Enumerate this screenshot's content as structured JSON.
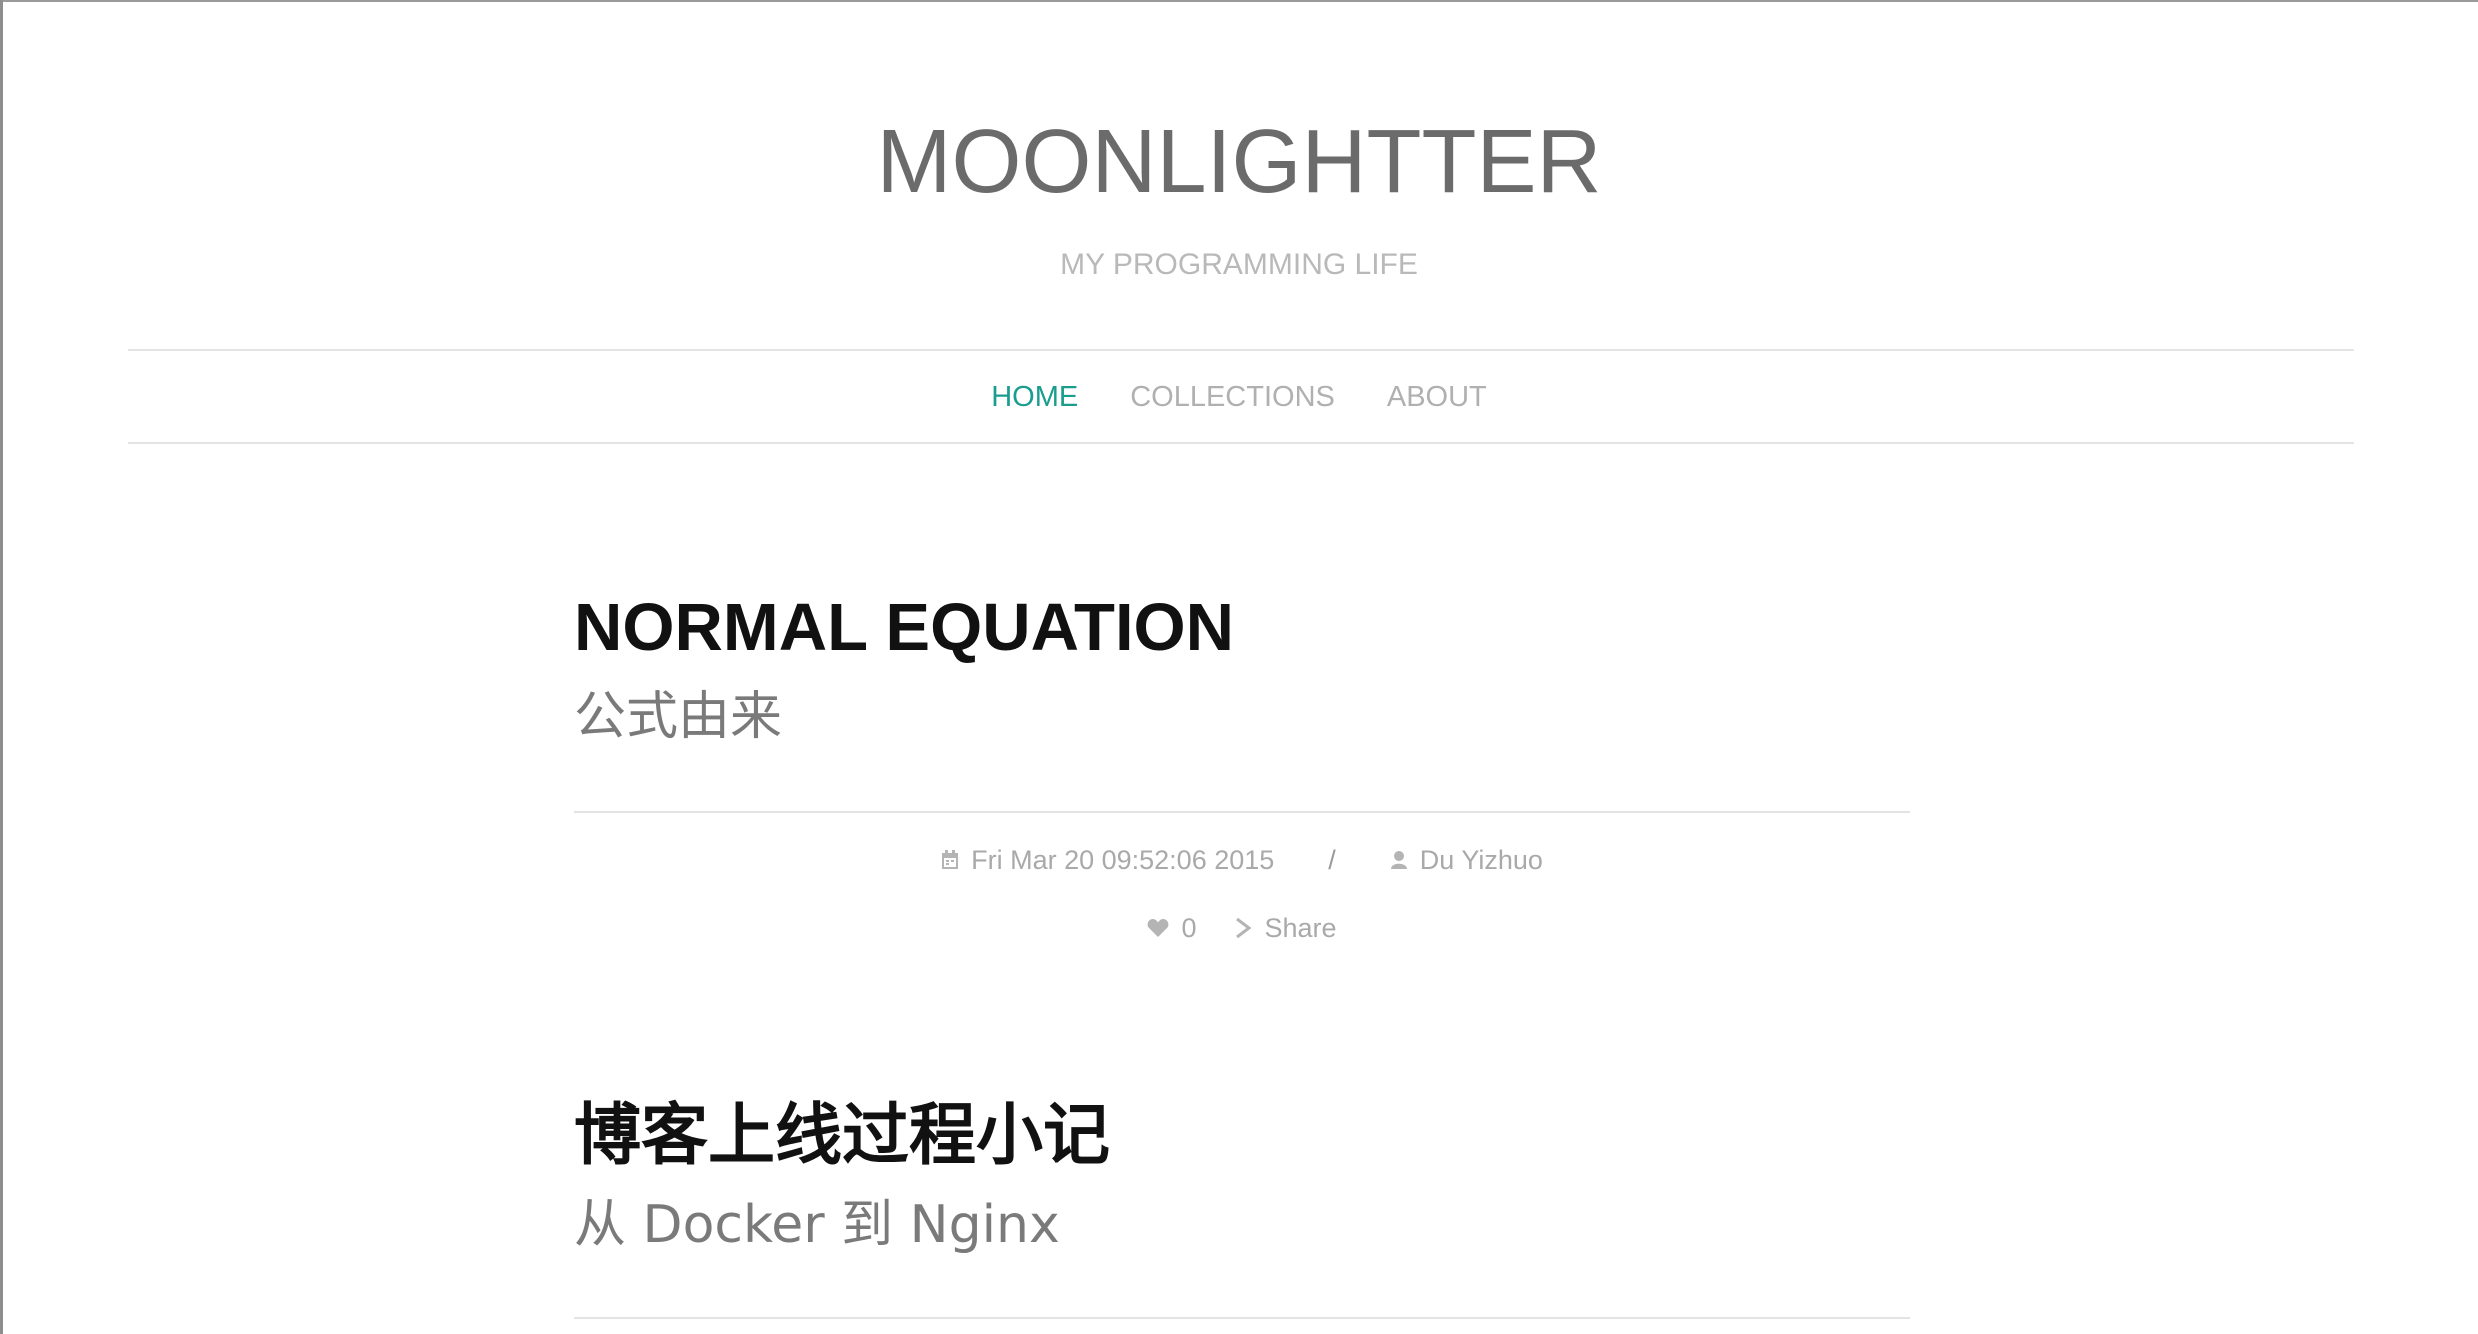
{
  "site": {
    "title": "MOONLIGHTTER",
    "subtitle": "MY PROGRAMMING LIFE"
  },
  "nav": {
    "items": [
      {
        "label": "HOME",
        "active": true
      },
      {
        "label": "COLLECTIONS",
        "active": false
      },
      {
        "label": "ABOUT",
        "active": false
      }
    ]
  },
  "posts": [
    {
      "title": "NORMAL EQUATION",
      "subtitle": "公式由来",
      "date": "Fri Mar 20 09:52:06 2015",
      "separator": "/",
      "author": "Du Yizhuo",
      "likes": "0",
      "share_label": "Share"
    },
    {
      "title": "博客上线过程小记",
      "subtitle": "从 Docker 到 Nginx"
    }
  ],
  "colors": {
    "accent": "#1a9d8f",
    "title": "#6b6b6b",
    "muted": "#b0b0b0"
  },
  "icons": {
    "date": "calendar-icon",
    "author": "user-icon",
    "like": "heart-icon",
    "share": "chevron-right-icon"
  }
}
